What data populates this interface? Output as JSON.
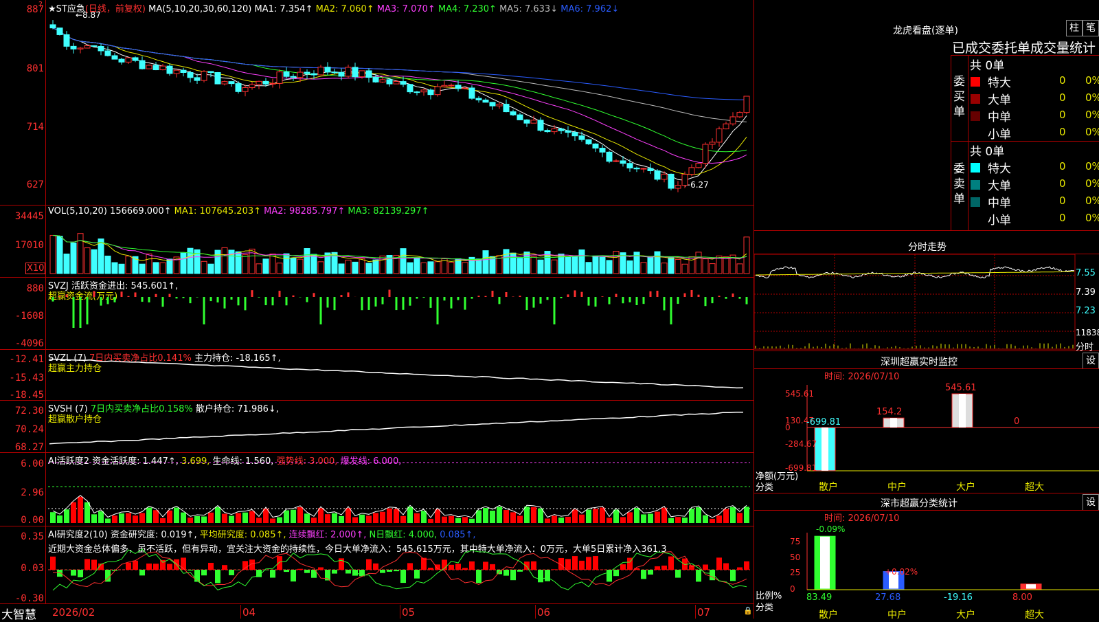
{
  "main_panel": {
    "title": "★ST应急",
    "period": "(日线，前复权)",
    "ma_label": "MA(5,10,20,30,60,120)",
    "ma_values": [
      "MA1: 7.354↑",
      "MA2: 7.060↑",
      "MA3: 7.070↑",
      "MA4: 7.230↑",
      "MA5: 7.633↓",
      "MA6: 7.962↓"
    ],
    "price_axis": [
      "887",
      "801",
      "714",
      "627"
    ],
    "high_marker": "8.87",
    "low_marker": "6.27"
  },
  "vol_panel": {
    "label": "VOL(5,10,20)",
    "value": "156669.000↑",
    "ma1": "MA1: 107645.203↑",
    "ma2": "MA2: 98285.797↑",
    "ma3": "MA3: 82139.297↑",
    "axis": [
      "34445",
      "17010"
    ],
    "unit": "X10"
  },
  "svzj_panel": {
    "label": "SVZJ  活跃资金进出: 545.601↑,",
    "sublabel": "超赢资金流(万元)",
    "axis": [
      "880",
      "-1608",
      "-4096"
    ]
  },
  "svzl_panel": {
    "label": "SVZL (7)",
    "ratio": "7日内买卖净占比0.141%",
    "hold": "主力持仓: -18.165↑,",
    "sublabel": "超赢主力持仓",
    "axis": [
      "-12.41",
      "-15.43",
      "-18.45"
    ]
  },
  "svsh_panel": {
    "label": "SVSH (7)",
    "ratio": "7日内买卖净占比0.158%",
    "hold": "散户持仓: 71.986↓,",
    "sublabel": "超赢散户持仓",
    "axis": [
      "72.30",
      "70.24",
      "68.27"
    ]
  },
  "ai_active_panel": {
    "label": "AI活跃度2",
    "v1": "资金活跃度: 1.447↑,",
    "v2": "3.699,",
    "v3": "生命线: 1.560,",
    "v4": "强势线: 3.000,",
    "v5": "爆发线: 6.000,",
    "axis": [
      "6.00",
      "2.96",
      "0.00"
    ]
  },
  "ai_research_panel": {
    "label": "AI研究度2(10)",
    "v1": "资金研究度: 0.019↑,",
    "v2": "平均研究度: 0.085↑,",
    "v3": "连续飘红: 2.000↑,",
    "v4": "N日飘红: 4.000,",
    "v5": "0.085↑,",
    "comment": "近期大资金总体偏多，虽不活跃，但有异动，宜关注大资金的持续性，今日大单净流入：545.615万元，其中特大单净流入：0万元，大单5日累计净入361.3",
    "axis": [
      "0.35",
      "0.03",
      "-0.30"
    ]
  },
  "date_axis": [
    "2026/02",
    "04",
    "05",
    "06",
    "07"
  ],
  "brand": "大智慧",
  "right": {
    "dragon_title": "龙虎看盘(逐单)",
    "btn_column": "柱",
    "btn_pen": "笔",
    "stats_title": "已成交委托单成交量统计",
    "buy_side": "委买单",
    "sell_side": "委卖单",
    "buy_total": "共 0单",
    "sell_total": "共 0单",
    "buy_rows": [
      {
        "name": "特大",
        "count": "0",
        "pct": "0%",
        "color": "#ff0000"
      },
      {
        "name": "大单",
        "count": "0",
        "pct": "0%",
        "color": "#990000"
      },
      {
        "name": "中单",
        "count": "0",
        "pct": "0%",
        "color": "#660000"
      },
      {
        "name": "小单",
        "count": "0",
        "pct": "0%",
        "color": ""
      }
    ],
    "sell_rows": [
      {
        "name": "特大",
        "count": "0",
        "pct": "0%",
        "color": "#00ffff"
      },
      {
        "name": "大单",
        "count": "0",
        "pct": "0%",
        "color": "#008080"
      },
      {
        "name": "中单",
        "count": "0",
        "pct": "0%",
        "color": "#006666"
      },
      {
        "name": "小单",
        "count": "0",
        "pct": "0%",
        "color": ""
      }
    ],
    "intraday_title": "分时走势",
    "intraday_axis": [
      "7.55",
      "7.39",
      "7.23",
      "11838",
      "分时"
    ],
    "monitor_title": "深圳超赢实时监控",
    "monitor_set": "设",
    "monitor_time": "时间: 2026/07/10",
    "monitor_axis": [
      "545.61",
      "130.47",
      "0",
      "-284.67",
      "-699.81"
    ],
    "monitor_unit": "净额(万元)",
    "monitor_cat_label": "分类",
    "monitor_bars": [
      {
        "label": "散户",
        "value": -699.81,
        "text": "-699.81"
      },
      {
        "label": "中户",
        "value": 154.2,
        "text": "154.2"
      },
      {
        "label": "大户",
        "value": 545.61,
        "text": "545.61"
      },
      {
        "label": "超大",
        "value": 0,
        "text": "0"
      }
    ],
    "class_title": "深市超赢分类统计",
    "class_set": "设",
    "class_time": "时间: 2026/07/10",
    "class_axis": [
      "75",
      "50",
      "25",
      "0"
    ],
    "class_unit": "比例%",
    "class_cat_label": "分类",
    "class_bars": [
      {
        "label": "散户",
        "value": 83.49,
        "change": "-0.09%",
        "text": "83.49"
      },
      {
        "label": "中户",
        "value": 27.68,
        "change": "+0.02%",
        "text": "27.68"
      },
      {
        "label": "大户",
        "value": -19.16,
        "change": "",
        "text": "-19.16"
      },
      {
        "label": "超大",
        "value": 8.0,
        "change": "",
        "text": "8.00"
      }
    ]
  }
}
